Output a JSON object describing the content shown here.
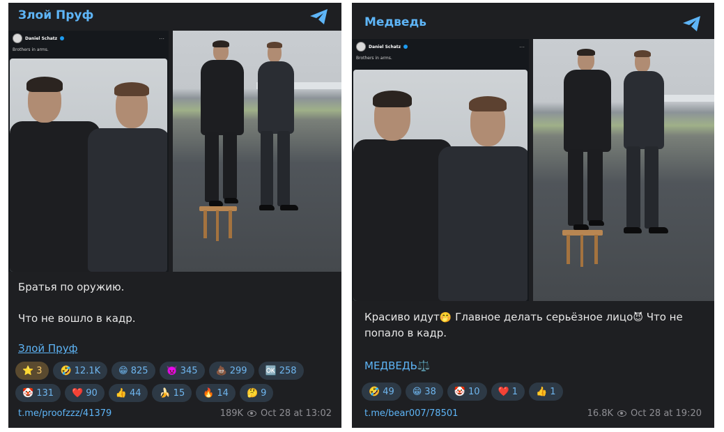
{
  "posts": [
    {
      "channel": "Злой Пруф",
      "tweet": {
        "author": "Daniel Schatz",
        "text": "Brothers in arms."
      },
      "message_lines": [
        "Братья по оружию.",
        "Что не вошло в кадр."
      ],
      "signature": "Злой Пруф",
      "reactions": [
        {
          "icon": "star-icon",
          "emoji": "⭐",
          "count": "3",
          "active": true
        },
        {
          "icon": "laughing-emoji-icon",
          "emoji": "🤣",
          "count": "12.1K"
        },
        {
          "icon": "grin-emoji-icon",
          "emoji": "😁",
          "count": "825"
        },
        {
          "icon": "devil-emoji-icon",
          "emoji": "👿",
          "count": "345"
        },
        {
          "icon": "poop-emoji-icon",
          "emoji": "💩",
          "count": "299"
        },
        {
          "icon": "lol-emoji-icon",
          "emoji": "🆗",
          "count": "258"
        },
        {
          "icon": "clown-emoji-icon",
          "emoji": "🤡",
          "count": "131"
        },
        {
          "icon": "heart-emoji-icon",
          "emoji": "❤️",
          "count": "90"
        },
        {
          "icon": "thumbs-up-emoji-icon",
          "emoji": "👍",
          "count": "44"
        },
        {
          "icon": "banana-emoji-icon",
          "emoji": "🍌",
          "count": "15"
        },
        {
          "icon": "fire-emoji-icon",
          "emoji": "🔥",
          "count": "14"
        },
        {
          "icon": "thinking-emoji-icon",
          "emoji": "🤔",
          "count": "9"
        }
      ],
      "link": "t.me/proofzzz/41379",
      "views": "189K",
      "date": "Oct 28 at 13:02"
    },
    {
      "channel": "Медведь",
      "tweet": {
        "author": "Daniel Schatz",
        "text": "Brothers in arms."
      },
      "message_parts": {
        "a": "Красиво идут",
        "emoji_a": "🤭",
        "b": " Главное делать серьёзное лицо",
        "emoji_b": "😈",
        "c": " Что не попало в кадр."
      },
      "signature": "МЕДВЕДЬ",
      "signature_emoji": "⚖️",
      "reactions": [
        {
          "icon": "laughing-emoji-icon",
          "emoji": "🤣",
          "count": "49"
        },
        {
          "icon": "grin-emoji-icon",
          "emoji": "😁",
          "count": "38"
        },
        {
          "icon": "clown-emoji-icon",
          "emoji": "🤡",
          "count": "10"
        },
        {
          "icon": "heart-emoji-icon",
          "emoji": "❤️",
          "count": "1"
        },
        {
          "icon": "thumbs-up-emoji-icon",
          "emoji": "👍",
          "count": "1"
        }
      ],
      "link": "t.me/bear007/78501",
      "views": "16.8K",
      "date": "Oct 28 at 19:20"
    }
  ],
  "colors": {
    "background": "#1e1f22",
    "accent": "#5eb5f7",
    "reaction_bg": "#2d3945",
    "muted": "#8e8e93"
  }
}
